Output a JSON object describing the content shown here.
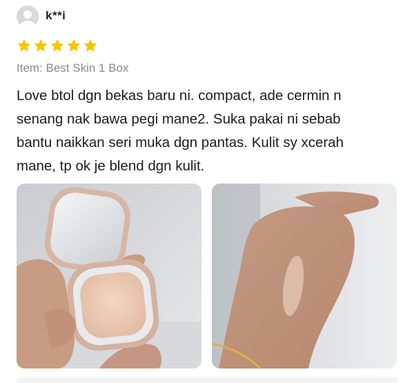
{
  "reviewer": {
    "avatar_icon": "user-avatar-icon",
    "name": "k**i"
  },
  "rating": {
    "stars": 5,
    "max": 5,
    "star_color": "#f7c600",
    "star_icon": "star-icon"
  },
  "item": {
    "label": "Item: Best Skin 1 Box"
  },
  "review": {
    "lines": [
      "Love btol dgn bekas baru ni. compact, ade cermin n",
      "senang nak bawa pegi mane2. Suka pakai ni sebab",
      "bantu naikkan seri muka dgn pantas. Kulit sy xcerah",
      "mane, tp ok je blend dgn kulit."
    ]
  },
  "photos": [
    {
      "subject": "compact-powder-photo"
    },
    {
      "subject": "hand-swatch-photo"
    }
  ]
}
